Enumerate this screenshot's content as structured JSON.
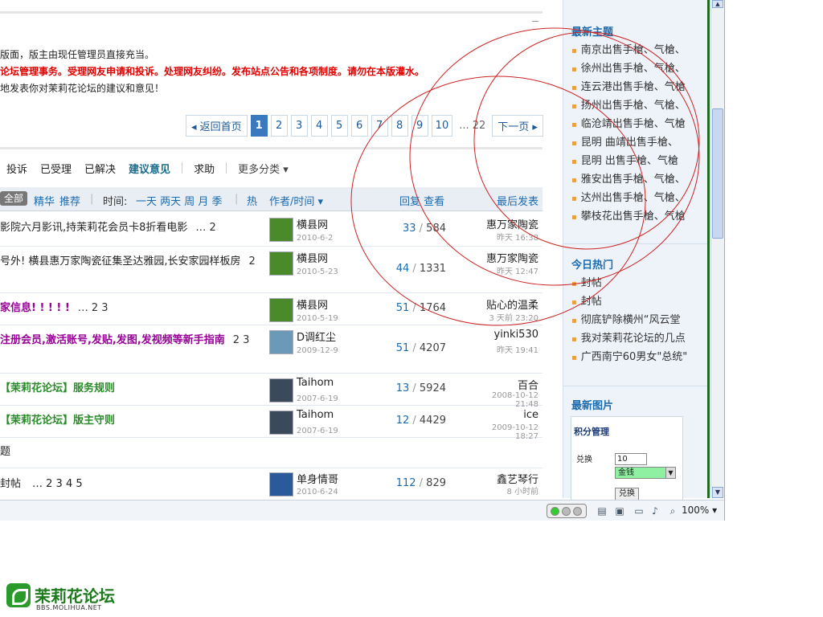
{
  "notice": {
    "line1": "版面，版主由现任管理员直接充当。",
    "line2": "论坛管理事务。受理网友申请和投诉。处理网友纠纷。发布站点公告和各项制度。请勿在本版灌水。",
    "line3": "地发表你对茉莉花论坛的建议和意见！"
  },
  "pager": {
    "back": "◂ 返回首页",
    "pages": [
      "1",
      "2",
      "3",
      "4",
      "5",
      "6",
      "7",
      "8",
      "9",
      "10"
    ],
    "ellipsis": "... 22",
    "next": "下一页 ▸"
  },
  "categories": {
    "items": [
      "投诉",
      "已受理",
      "已解决",
      "建议意见",
      "求助"
    ],
    "more": "更多分类 ▾"
  },
  "thead": {
    "all": "全部",
    "digest": "精华",
    "recommend": "推荐",
    "time_label": "时间:",
    "time_opts": "一天 两天 周 月 季",
    "hot": "热",
    "author": "作者/时间 ▾",
    "replies": "回复 查看",
    "last": "最后发表"
  },
  "rows": [
    {
      "title": "影院六月影讯,持茉莉花会员卡8折看电影",
      "pages": "… 2",
      "author": "横县网",
      "date": "2010-6-2",
      "replies": "33",
      "views": "584",
      "last": "惠万家陶瓷",
      "last_date": "昨天 16:38",
      "color": "#222222"
    },
    {
      "title": "号外! 横县惠万家陶瓷征集圣达雅园,长安家园样板房",
      "pages": "2",
      "author": "横县网",
      "date": "2010-5-23",
      "replies": "44",
      "views": "1331",
      "last": "惠万家陶瓷",
      "last_date": "昨天 12:47",
      "color": "#222222"
    },
    {
      "title": "家信息! ! ! ! !",
      "pages": "… 2 3",
      "author": "横县网",
      "date": "2010-5-19",
      "replies": "51",
      "views": "1764",
      "last": "贴心的温柔",
      "last_date": "3 天前 23:20",
      "color": "#990099"
    },
    {
      "title": "注册会员,激活账号,发贴,发图,发视频等新手指南",
      "pages": "2 3",
      "author": "D调红尘",
      "date": "2009-12-9",
      "replies": "51",
      "views": "4207",
      "last": "yinki530",
      "last_date": "昨天 19:41",
      "color": "#990099"
    },
    {
      "title": "【茉莉花论坛】服务规则",
      "pages": "",
      "author": "Taihom",
      "date": "2007-6-19",
      "replies": "13",
      "views": "5924",
      "last": "百合",
      "last_date": "2008-10-12 21:48",
      "color": "#2a8a2a"
    },
    {
      "title": "【茉莉花论坛】版主守则",
      "pages": "",
      "author": "Taihom",
      "date": "2007-6-19",
      "replies": "12",
      "views": "4429",
      "last": "ice",
      "last_date": "2009-10-12 18:27",
      "color": "#2a8a2a"
    }
  ],
  "section_label": "题",
  "last_row": {
    "title": "封帖",
    "pages": "… 2 3 4 5",
    "author": "单身情哥",
    "date": "2010-6-24",
    "replies": "112",
    "views": "829",
    "last": "鑫艺琴行",
    "last_date": "8 小时前"
  },
  "sidebar": {
    "latest_title": "最新主题",
    "latest": [
      "南京出售手槍、气槍、",
      "徐州出售手槍、气槍、",
      "连云港出售手槍、气槍",
      "扬州出售手槍、气槍、",
      "临沧靖出售手槍、气槍",
      "昆明 曲靖出售手槍、",
      "昆明 出售手槍、气槍",
      "雅安出售手槍、气槍、",
      "达州出售手槍、气槍、",
      "攀枝花出售手槍、气槍"
    ],
    "hot_title": "今日热门",
    "hot": [
      "封帖",
      "封帖",
      "彻底铲除横州“风云堂",
      "我对茉莉花论坛的几点",
      "广西南宁60男女\"总统\""
    ],
    "pic_title": "最新图片",
    "pic_panel": {
      "title": "积分管理",
      "label": "兑换",
      "input": "10",
      "select": "金钱",
      "button": "兑换"
    }
  },
  "statusbar": {
    "zoom": "100% ▾"
  },
  "logo": {
    "name": "茉莉花论坛",
    "url": "BBS.MOLIHUA.NET"
  }
}
